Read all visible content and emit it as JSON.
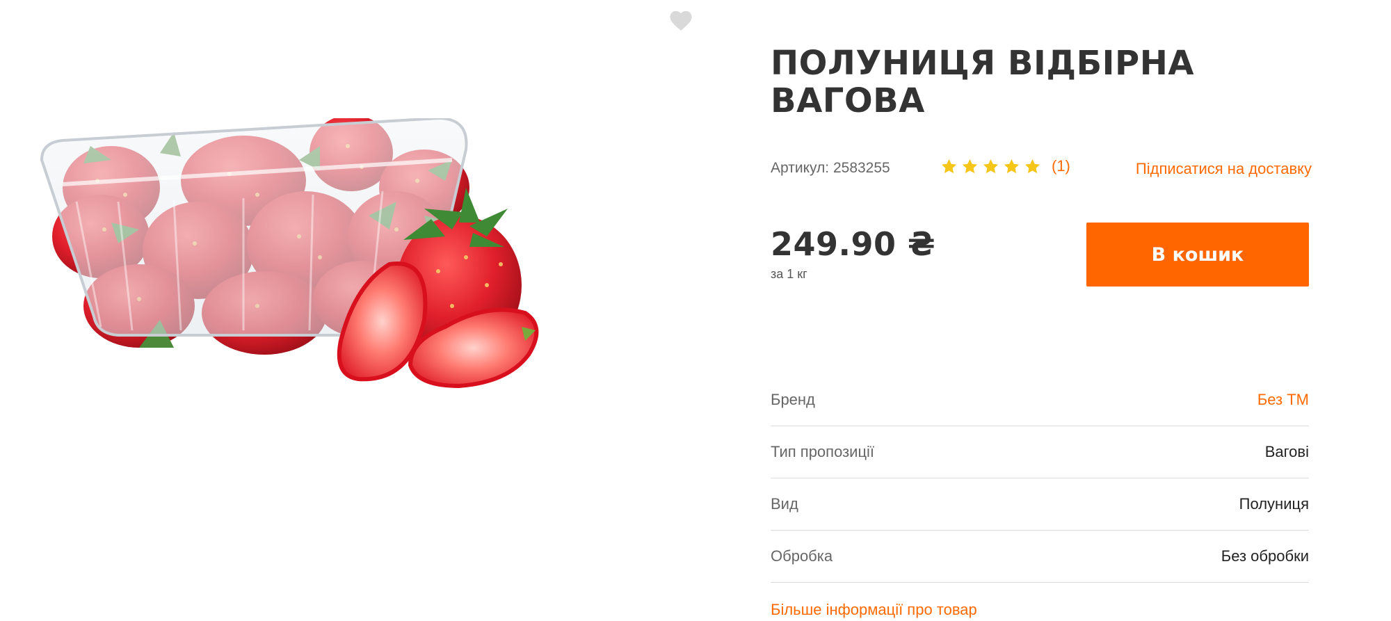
{
  "product": {
    "title": "ПОЛУНИЦЯ ВІДБІРНА ВАГОВА",
    "sku_label": "Артикул:",
    "sku_value": "2583255",
    "rating": {
      "stars": 5,
      "max": 5,
      "count_label": "(1)"
    },
    "subscribe_label": "Підписатися на доставку",
    "price": "249.90 ₴",
    "unit": "за 1 кг",
    "cart_button": "В кошик"
  },
  "properties": [
    {
      "label": "Бренд",
      "value": "Без ТМ",
      "is_link": true
    },
    {
      "label": "Тип пропозиції",
      "value": "Вагові",
      "is_link": false
    },
    {
      "label": "Вид",
      "value": "Полуниця",
      "is_link": false
    },
    {
      "label": "Обробка",
      "value": "Без обробки",
      "is_link": false
    }
  ],
  "more_info_label": "Більше інформації про товар",
  "colors": {
    "accent": "#ff6600",
    "link": "#ff6a00",
    "star": "#f5c518",
    "favorite": "#d9d9d9"
  },
  "icons": {
    "favorite": "heart-icon",
    "rating": "star-icon"
  }
}
